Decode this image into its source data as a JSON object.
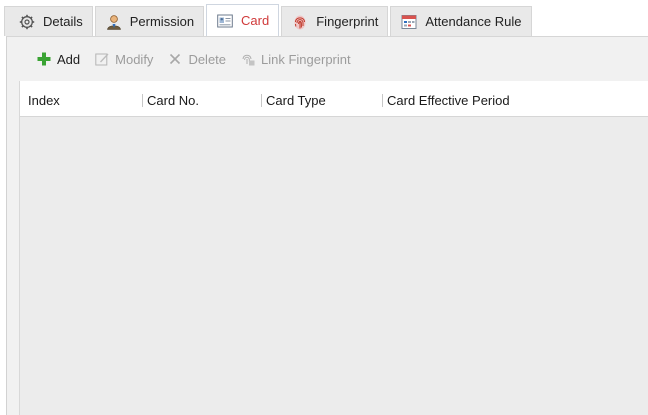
{
  "tabs": [
    {
      "label": "Details",
      "icon": "gear-icon",
      "active": false
    },
    {
      "label": "Permission",
      "icon": "user-icon",
      "active": false
    },
    {
      "label": "Card",
      "icon": "card-icon",
      "active": true
    },
    {
      "label": "Fingerprint",
      "icon": "fingerprint-icon",
      "active": false
    },
    {
      "label": "Attendance Rule",
      "icon": "calendar-icon",
      "active": false
    }
  ],
  "toolbar": {
    "add_label": "Add",
    "modify_label": "Modify",
    "delete_label": "Delete",
    "link_fingerprint_label": "Link Fingerprint"
  },
  "table": {
    "columns": [
      "Index",
      "Card No.",
      "Card Type",
      "Card Effective Period"
    ],
    "rows": []
  },
  "colors": {
    "active_tab_text": "#d03a3a",
    "add_icon": "#3aa333",
    "disabled_text": "#9c9c9c"
  }
}
